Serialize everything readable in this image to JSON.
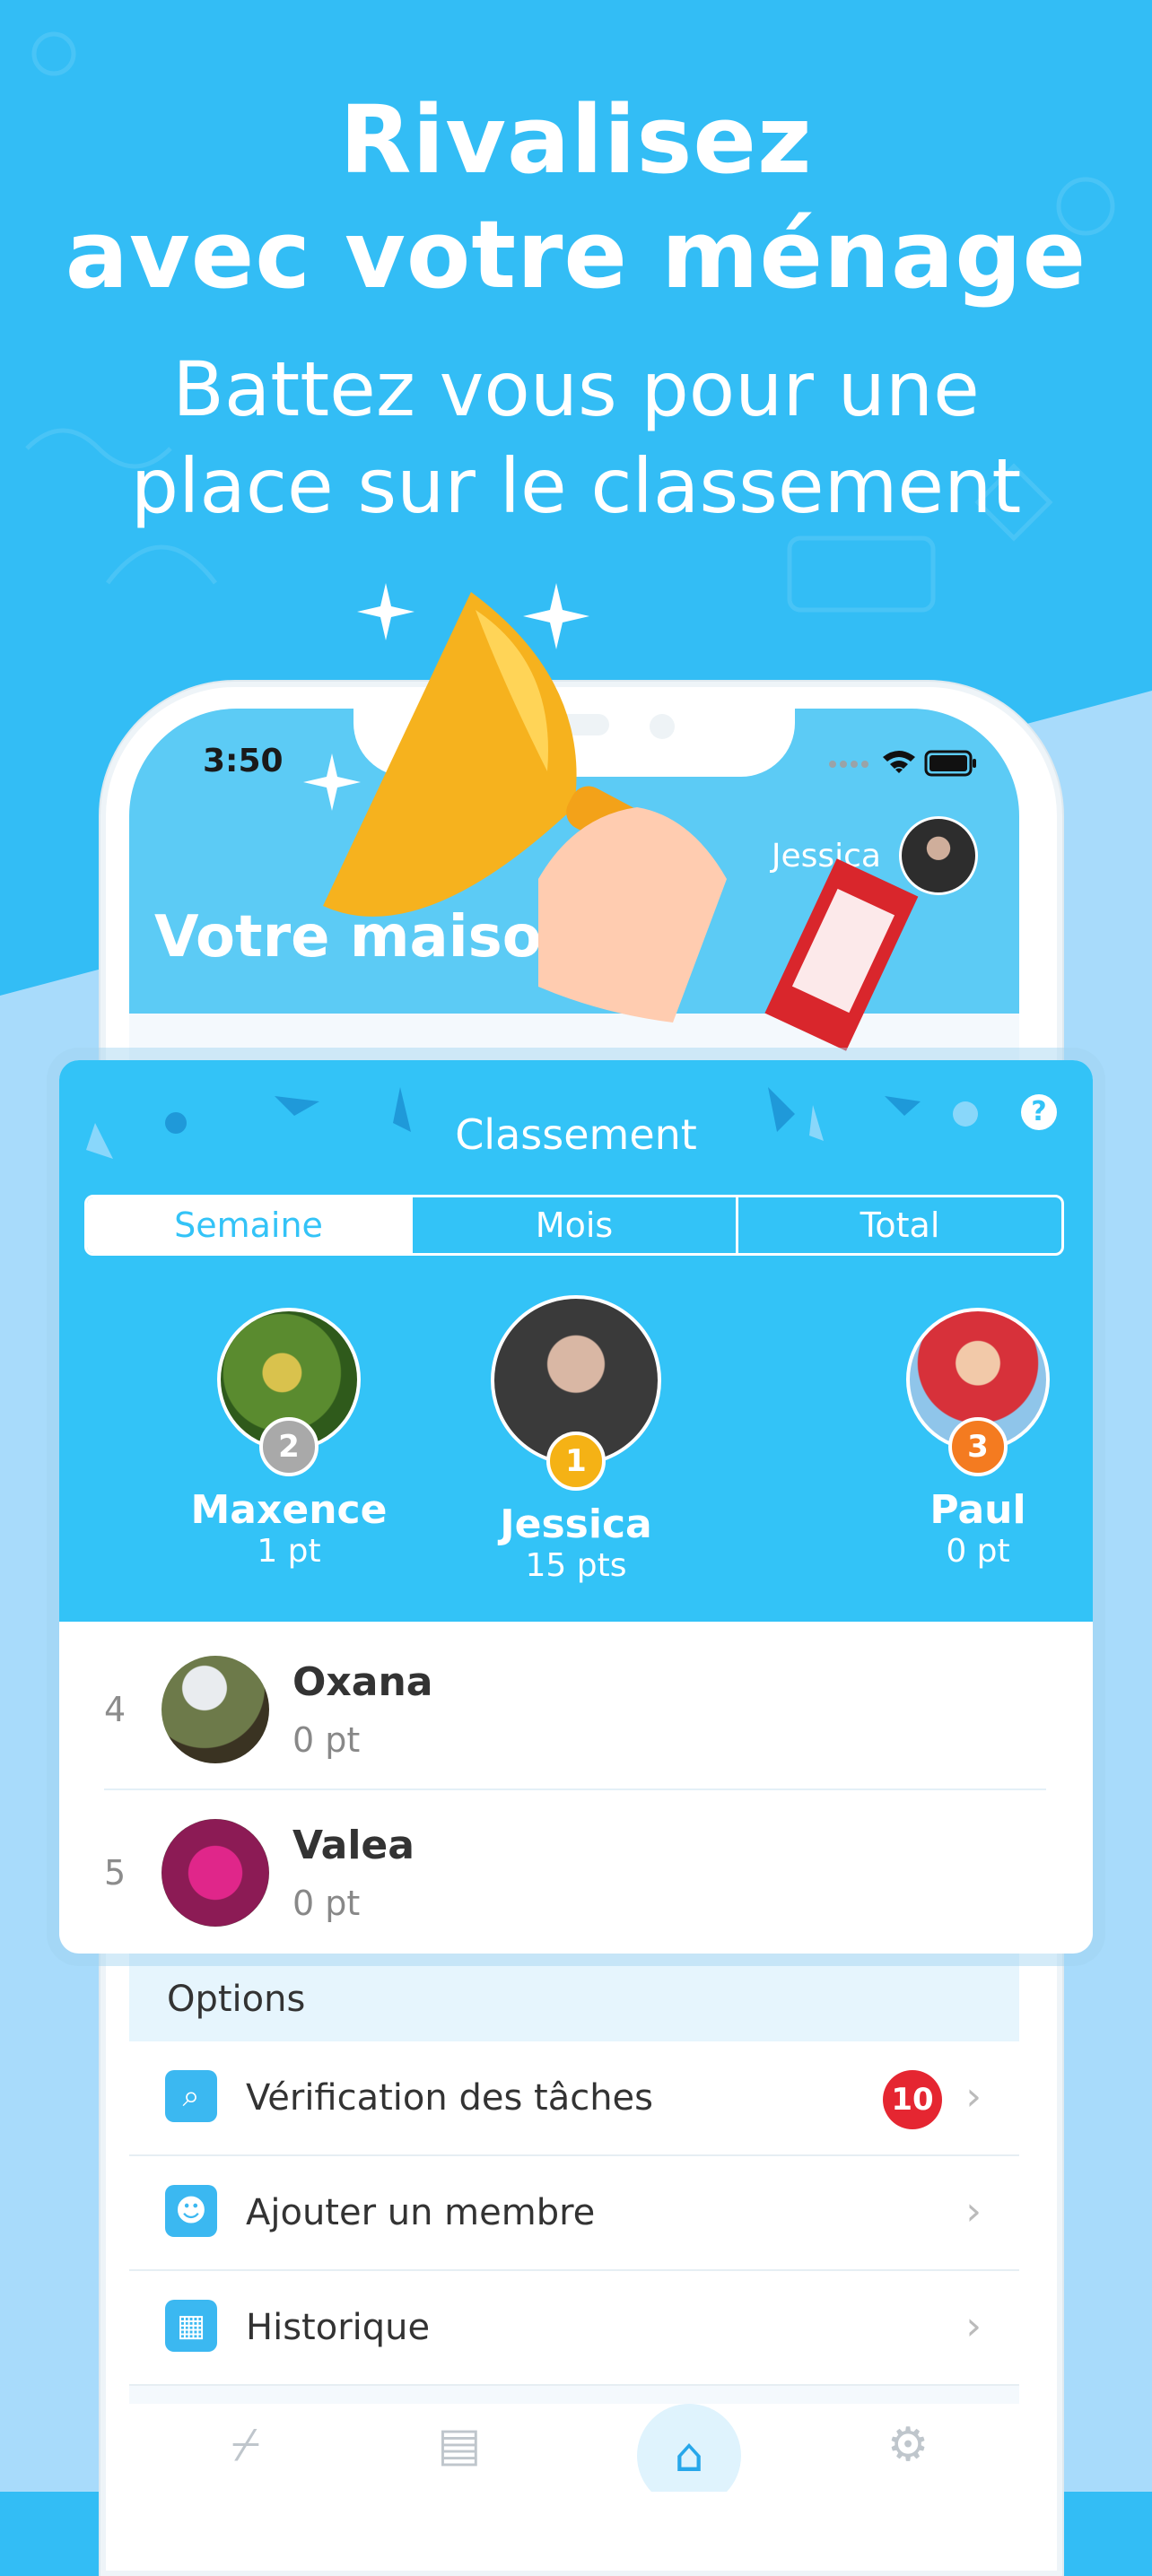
{
  "promo": {
    "title_line1": "Rivalisez",
    "title_line2": "avec votre ménage",
    "subtitle_line1": "Battez vous pour une",
    "subtitle_line2": "place sur le classement"
  },
  "status_bar": {
    "time": "3:50"
  },
  "header": {
    "user_name": "Jessica",
    "title": "Votre maison"
  },
  "leaderboard": {
    "title": "Classement",
    "help": "?",
    "tabs": [
      "Semaine",
      "Mois",
      "Total"
    ],
    "podium": [
      {
        "rank": "2",
        "name": "Maxence",
        "points": "1 pt"
      },
      {
        "rank": "1",
        "name": "Jessica",
        "points": "15 pts"
      },
      {
        "rank": "3",
        "name": "Paul",
        "points": "0 pt"
      }
    ],
    "rows": [
      {
        "rank": "4",
        "name": "Oxana",
        "points": "0 pt"
      },
      {
        "rank": "5",
        "name": "Valea",
        "points": "0 pt"
      }
    ]
  },
  "options": {
    "heading": "Options",
    "items": [
      {
        "label": "Vérification des tâches",
        "icon": "search-icon",
        "badge": "10"
      },
      {
        "label": "Ajouter un membre",
        "icon": "person-icon"
      },
      {
        "label": "Historique",
        "icon": "calendar-icon"
      }
    ]
  },
  "tabbar": [
    "broom-icon",
    "clipboard-icon",
    "home-icon",
    "gear-icon"
  ],
  "colors": {
    "primary": "#33c3f7",
    "badge": "#e52631",
    "background": "#33bdf5"
  }
}
